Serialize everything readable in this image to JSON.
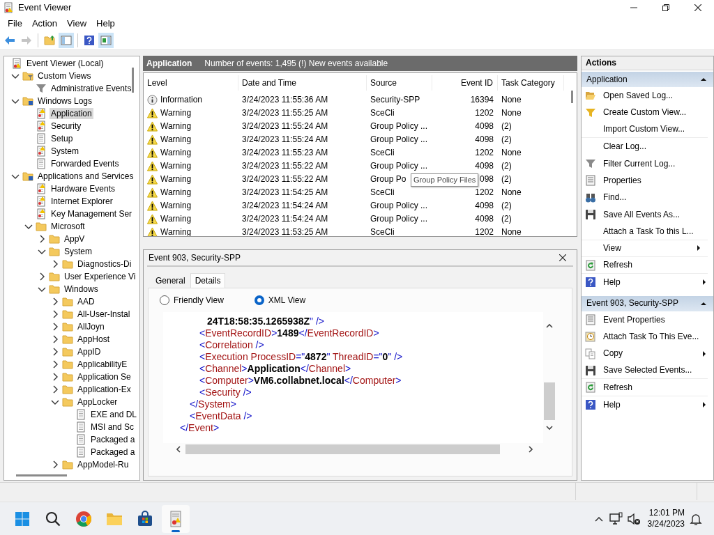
{
  "window": {
    "title": "Event Viewer"
  },
  "menu": [
    "File",
    "Action",
    "View",
    "Help"
  ],
  "toolbar": {
    "groups": [
      [
        {
          "kind": "back",
          "disabled": false,
          "pressed": false
        },
        {
          "kind": "forward",
          "disabled": true,
          "pressed": false
        }
      ],
      [
        {
          "kind": "up",
          "disabled": false,
          "pressed": false
        },
        {
          "kind": "tree-toggle",
          "disabled": false,
          "pressed": true
        }
      ],
      [
        {
          "kind": "help",
          "disabled": false,
          "pressed": false
        },
        {
          "kind": "actions-toggle",
          "disabled": false,
          "pressed": true
        }
      ]
    ]
  },
  "tree": {
    "items": [
      {
        "label": "Event Viewer (Local)",
        "kind": "root",
        "selected": false,
        "children": [
          {
            "label": "Custom Views",
            "kind": "custom-views",
            "expanded": true,
            "selected": false,
            "children": [
              {
                "label": "Administrative Events",
                "kind": "view",
                "selected": false
              }
            ]
          },
          {
            "label": "Windows Logs",
            "kind": "logs-folder",
            "expanded": true,
            "selected": false,
            "children": [
              {
                "label": "Application",
                "kind": "alert-log",
                "selected": true
              },
              {
                "label": "Security",
                "kind": "alert-log",
                "selected": false
              },
              {
                "label": "Setup",
                "kind": "log",
                "selected": false
              },
              {
                "label": "System",
                "kind": "alert-log",
                "selected": false
              },
              {
                "label": "Forwarded Events",
                "kind": "log",
                "selected": false
              }
            ]
          },
          {
            "label": "Applications and Services",
            "kind": "logs-folder",
            "expanded": true,
            "selected": false,
            "children": [
              {
                "label": "Hardware Events",
                "kind": "alert-log",
                "selected": false
              },
              {
                "label": "Internet Explorer",
                "kind": "alert-log",
                "selected": false
              },
              {
                "label": "Key Management Ser",
                "kind": "alert-log",
                "selected": false
              },
              {
                "label": "Microsoft",
                "kind": "folder",
                "expanded": true,
                "selected": false,
                "children": [
                  {
                    "label": "AppV",
                    "kind": "folder",
                    "expanded": false,
                    "selected": false
                  },
                  {
                    "label": "System",
                    "kind": "folder",
                    "expanded": true,
                    "selected": false,
                    "children": [
                      {
                        "label": "Diagnostics-Di",
                        "kind": "folder",
                        "expanded": false,
                        "selected": false
                      }
                    ]
                  },
                  {
                    "label": "User Experience Vi",
                    "kind": "folder",
                    "expanded": false,
                    "selected": false
                  },
                  {
                    "label": "Windows",
                    "kind": "folder",
                    "expanded": true,
                    "selected": false,
                    "children": [
                      {
                        "label": "AAD",
                        "kind": "folder",
                        "expanded": false,
                        "selected": false
                      },
                      {
                        "label": "All-User-Instal",
                        "kind": "folder",
                        "expanded": false,
                        "selected": false
                      },
                      {
                        "label": "AllJoyn",
                        "kind": "folder",
                        "expanded": false,
                        "selected": false
                      },
                      {
                        "label": "AppHost",
                        "kind": "folder",
                        "expanded": false,
                        "selected": false
                      },
                      {
                        "label": "AppID",
                        "kind": "folder",
                        "expanded": false,
                        "selected": false
                      },
                      {
                        "label": "ApplicabilityE",
                        "kind": "folder",
                        "expanded": false,
                        "selected": false
                      },
                      {
                        "label": "Application Se",
                        "kind": "folder",
                        "expanded": false,
                        "selected": false
                      },
                      {
                        "label": "Application-Ex",
                        "kind": "folder",
                        "expanded": false,
                        "selected": false
                      },
                      {
                        "label": "AppLocker",
                        "kind": "folder",
                        "expanded": true,
                        "selected": false,
                        "children": [
                          {
                            "label": "EXE and DL",
                            "kind": "log",
                            "selected": false
                          },
                          {
                            "label": "MSI and Sc",
                            "kind": "log",
                            "selected": false
                          },
                          {
                            "label": "Packaged a",
                            "kind": "log",
                            "selected": false
                          },
                          {
                            "label": "Packaged a",
                            "kind": "log",
                            "selected": false
                          }
                        ]
                      },
                      {
                        "label": "AppModel-Ru",
                        "kind": "folder",
                        "expanded": false,
                        "selected": false
                      }
                    ]
                  }
                ]
              }
            ]
          }
        ]
      }
    ]
  },
  "log_header": {
    "title": "Application",
    "summary": "Number of events: 1,495 (!) New events available"
  },
  "events": {
    "columns": [
      "Level",
      "Date and Time",
      "Source",
      "Event ID",
      "Task Category"
    ],
    "rows": [
      {
        "kind": "information",
        "severity": "Information",
        "date": "3/24/2023 11:55:36 AM",
        "source": "Security-SPP",
        "event_id": "16394",
        "task_category": "None"
      },
      {
        "kind": "warning",
        "severity": "Warning",
        "date": "3/24/2023 11:55:25 AM",
        "source": "SceCli",
        "event_id": "1202",
        "task_category": "None"
      },
      {
        "kind": "warning",
        "severity": "Warning",
        "date": "3/24/2023 11:55:24 AM",
        "source": "Group Policy ...",
        "event_id": "4098",
        "task_category": "(2)"
      },
      {
        "kind": "warning",
        "severity": "Warning",
        "date": "3/24/2023 11:55:24 AM",
        "source": "Group Policy ...",
        "event_id": "4098",
        "task_category": "(2)"
      },
      {
        "kind": "warning",
        "severity": "Warning",
        "date": "3/24/2023 11:55:23 AM",
        "source": "SceCli",
        "event_id": "1202",
        "task_category": "None"
      },
      {
        "kind": "warning",
        "severity": "Warning",
        "date": "3/24/2023 11:55:22 AM",
        "source": "Group Policy ...",
        "event_id": "4098",
        "task_category": "(2)"
      },
      {
        "kind": "warning",
        "severity": "Warning",
        "date": "3/24/2023 11:55:22 AM",
        "source": "Group Po",
        "event_id": "098",
        "task_category": "(2)"
      },
      {
        "kind": "warning",
        "severity": "Warning",
        "date": "3/24/2023 11:54:25 AM",
        "source": "SceCli",
        "event_id": "1202",
        "task_category": "None"
      },
      {
        "kind": "warning",
        "severity": "Warning",
        "date": "3/24/2023 11:54:24 AM",
        "source": "Group Policy ...",
        "event_id": "4098",
        "task_category": "(2)"
      },
      {
        "kind": "warning",
        "severity": "Warning",
        "date": "3/24/2023 11:54:24 AM",
        "source": "Group Policy ...",
        "event_id": "4098",
        "task_category": "(2)"
      },
      {
        "kind": "warning",
        "severity": "Warning",
        "date": "3/24/2023 11:53:25 AM",
        "source": "SceCli",
        "event_id": "1202",
        "task_category": "None"
      }
    ],
    "tooltip": "Group Policy Files"
  },
  "detail": {
    "title": "Event 903, Security-SPP",
    "tabs": [
      {
        "label": "General",
        "selected": false
      },
      {
        "label": "Details",
        "selected": true
      }
    ],
    "views": [
      {
        "label": "Friendly View",
        "selected": false
      },
      {
        "label": "XML View",
        "selected": true
      }
    ],
    "xml": [
      {
        "children": [
          {
            "children": [
              {
                "children": [
                  {
                    "parts": [
                      {
                        "kind": "value",
                        "text": "24T18:58:35.1265938Z"
                      },
                      {
                        "kind": "punct",
                        "text": "\" />"
                      }
                    ]
                  }
                ]
              },
              {
                "parts": [
                  {
                    "kind": "punct",
                    "text": "<"
                  },
                  {
                    "kind": "name",
                    "text": "EventRecordID"
                  },
                  {
                    "kind": "punct",
                    "text": ">"
                  },
                  {
                    "kind": "value",
                    "text": "1489"
                  },
                  {
                    "kind": "punct",
                    "text": "</"
                  },
                  {
                    "kind": "name",
                    "text": "EventRecordID"
                  },
                  {
                    "kind": "punct",
                    "text": ">"
                  }
                ]
              },
              {
                "parts": [
                  {
                    "kind": "punct",
                    "text": "<"
                  },
                  {
                    "kind": "name",
                    "text": "Correlation"
                  },
                  {
                    "kind": "punct",
                    "text": " />"
                  }
                ]
              },
              {
                "parts": [
                  {
                    "kind": "punct",
                    "text": "<"
                  },
                  {
                    "kind": "name",
                    "text": "Execution ProcessID"
                  },
                  {
                    "kind": "punct",
                    "text": "=\""
                  },
                  {
                    "kind": "value",
                    "text": "4872"
                  },
                  {
                    "kind": "punct",
                    "text": "\" "
                  },
                  {
                    "kind": "name",
                    "text": "ThreadID"
                  },
                  {
                    "kind": "punct",
                    "text": "=\""
                  },
                  {
                    "kind": "value",
                    "text": "0"
                  },
                  {
                    "kind": "punct",
                    "text": "\" />"
                  }
                ]
              },
              {
                "parts": [
                  {
                    "kind": "punct",
                    "text": "<"
                  },
                  {
                    "kind": "name",
                    "text": "Channel"
                  },
                  {
                    "kind": "punct",
                    "text": ">"
                  },
                  {
                    "kind": "value",
                    "text": "Application"
                  },
                  {
                    "kind": "punct",
                    "text": "</"
                  },
                  {
                    "kind": "name",
                    "text": "Channel"
                  },
                  {
                    "kind": "punct",
                    "text": ">"
                  }
                ]
              },
              {
                "parts": [
                  {
                    "kind": "punct",
                    "text": "<"
                  },
                  {
                    "kind": "name",
                    "text": "Computer"
                  },
                  {
                    "kind": "punct",
                    "text": ">"
                  },
                  {
                    "kind": "value",
                    "text": "VM6.collabnet.local"
                  },
                  {
                    "kind": "punct",
                    "text": "</"
                  },
                  {
                    "kind": "name",
                    "text": "Computer"
                  },
                  {
                    "kind": "punct",
                    "text": ">"
                  }
                ]
              },
              {
                "parts": [
                  {
                    "kind": "punct",
                    "text": "<"
                  },
                  {
                    "kind": "name",
                    "text": "Security"
                  },
                  {
                    "kind": "punct",
                    "text": " />"
                  }
                ]
              }
            ]
          },
          {
            "parts": [
              {
                "kind": "punct",
                "text": "</"
              },
              {
                "kind": "name",
                "text": "System"
              },
              {
                "kind": "punct",
                "text": ">"
              }
            ]
          },
          {
            "parts": [
              {
                "kind": "punct",
                "text": "<"
              },
              {
                "kind": "name",
                "text": "EventData"
              },
              {
                "kind": "punct",
                "text": " />"
              }
            ]
          }
        ]
      },
      {
        "parts": [
          {
            "kind": "punct",
            "text": "</"
          },
          {
            "kind": "name",
            "text": "Event"
          },
          {
            "kind": "punct",
            "text": ">"
          }
        ]
      }
    ]
  },
  "actions": {
    "title": "Actions",
    "sections": [
      {
        "title": "Application",
        "expanded": true,
        "items": [
          {
            "label": "Open Saved Log...",
            "kind": "open",
            "submenu": false,
            "divider": false
          },
          {
            "label": "Create Custom View...",
            "kind": "create-view",
            "submenu": false,
            "divider": false
          },
          {
            "label": "Import Custom View...",
            "kind": "plain",
            "submenu": false,
            "divider": true
          },
          {
            "label": "Clear Log...",
            "kind": "plain",
            "submenu": false,
            "divider": false
          },
          {
            "label": "Filter Current Log...",
            "kind": "filter",
            "submenu": false,
            "divider": false
          },
          {
            "label": "Properties",
            "kind": "properties",
            "submenu": false,
            "divider": false
          },
          {
            "label": "Find...",
            "kind": "find",
            "submenu": false,
            "divider": false
          },
          {
            "label": "Save All Events As...",
            "kind": "save",
            "submenu": false,
            "divider": false
          },
          {
            "label": "Attach a Task To this L...",
            "kind": "plain",
            "submenu": false,
            "divider": true
          },
          {
            "label": "View",
            "kind": "plain",
            "submenu": true,
            "divider": true
          },
          {
            "label": "Refresh",
            "kind": "refresh",
            "submenu": false,
            "divider": true
          },
          {
            "label": "Help",
            "kind": "help",
            "submenu": true,
            "divider": false
          }
        ]
      },
      {
        "title": "Event 903, Security-SPP",
        "expanded": true,
        "items": [
          {
            "label": "Event Properties",
            "kind": "properties",
            "submenu": false,
            "divider": false
          },
          {
            "label": "Attach Task To This Eve...",
            "kind": "task",
            "submenu": false,
            "divider": false
          },
          {
            "label": "Copy",
            "kind": "copy",
            "submenu": true,
            "divider": false
          },
          {
            "label": "Save Selected Events...",
            "kind": "save",
            "submenu": false,
            "divider": true
          },
          {
            "label": "Refresh",
            "kind": "refresh",
            "submenu": false,
            "divider": true
          },
          {
            "label": "Help",
            "kind": "help",
            "submenu": true,
            "divider": false
          }
        ]
      }
    ]
  },
  "taskbar": {
    "apps": [
      {
        "kind": "start",
        "active": false
      },
      {
        "kind": "search",
        "active": false
      },
      {
        "kind": "browser",
        "active": false
      },
      {
        "kind": "files",
        "active": false
      },
      {
        "kind": "store",
        "active": false
      },
      {
        "kind": "eventviewer",
        "active": true
      }
    ],
    "clock": {
      "time": "12:01 PM",
      "date": "3/24/2023"
    }
  }
}
